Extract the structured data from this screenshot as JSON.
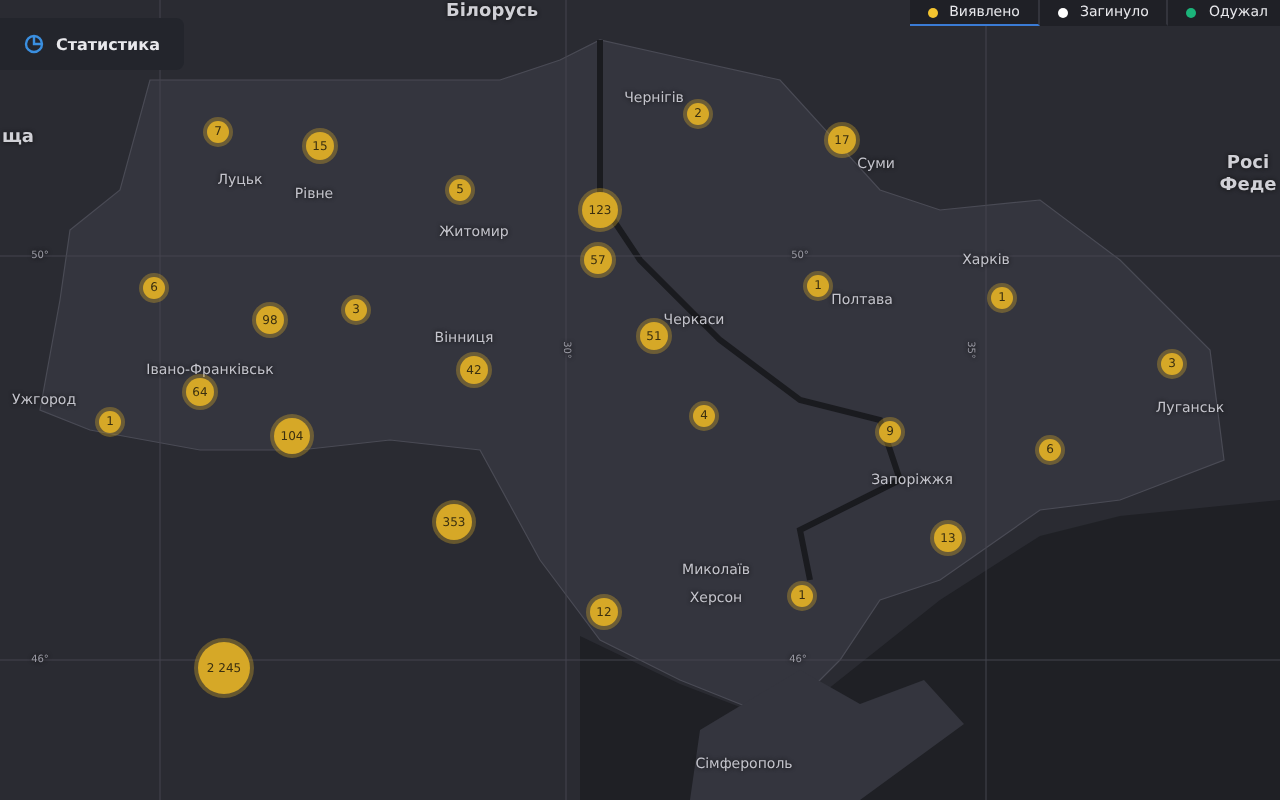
{
  "stats_button": {
    "label": "Статистика"
  },
  "tabs": [
    {
      "label": "Виявлено",
      "color": "#f4c430",
      "selected": true
    },
    {
      "label": "Загинуло",
      "color": "#ffffff",
      "selected": false
    },
    {
      "label": "Одужал",
      "color": "#1bb47a",
      "selected": false
    }
  ],
  "map": {
    "country_labels": [
      {
        "text": "Білорусь"
      },
      {
        "text": "ща"
      },
      {
        "text": "Росі"
      },
      {
        "text": "Феде"
      }
    ],
    "city_labels": [
      {
        "text": "Луцьк"
      },
      {
        "text": "Рівне"
      },
      {
        "text": "Житомир"
      },
      {
        "text": "Чернігів"
      },
      {
        "text": "Суми"
      },
      {
        "text": "Харків"
      },
      {
        "text": "Полтава"
      },
      {
        "text": "Черкаси"
      },
      {
        "text": "Вінниця"
      },
      {
        "text": "Івано-Франківськ"
      },
      {
        "text": "Ужгород"
      },
      {
        "text": "Луганськ"
      },
      {
        "text": "Запоріжжя"
      },
      {
        "text": "Миколаїв"
      },
      {
        "text": "Херсон"
      },
      {
        "text": "Сімферополь"
      }
    ],
    "grid_labels": [
      {
        "text": "50°"
      },
      {
        "text": "50°"
      },
      {
        "text": "46°"
      },
      {
        "text": "46°"
      },
      {
        "text": "30°"
      },
      {
        "text": "35°"
      }
    ],
    "clusters": [
      {
        "count": "7"
      },
      {
        "count": "15"
      },
      {
        "count": "5"
      },
      {
        "count": "123"
      },
      {
        "count": "57"
      },
      {
        "count": "2"
      },
      {
        "count": "17"
      },
      {
        "count": "6"
      },
      {
        "count": "98"
      },
      {
        "count": "3"
      },
      {
        "count": "1"
      },
      {
        "count": "1"
      },
      {
        "count": "51"
      },
      {
        "count": "42"
      },
      {
        "count": "64"
      },
      {
        "count": "1"
      },
      {
        "count": "104"
      },
      {
        "count": "4"
      },
      {
        "count": "9"
      },
      {
        "count": "6"
      },
      {
        "count": "3"
      },
      {
        "count": "353"
      },
      {
        "count": "13"
      },
      {
        "count": "12"
      },
      {
        "count": "1"
      },
      {
        "count": "2 245"
      }
    ]
  }
}
